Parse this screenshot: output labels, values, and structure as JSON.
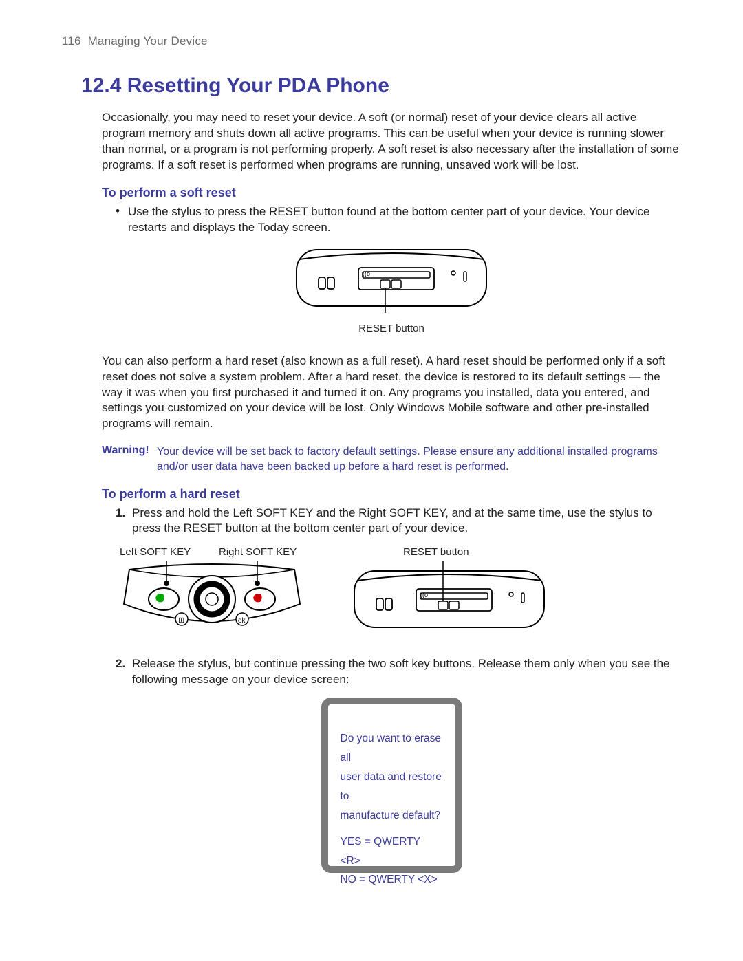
{
  "header": {
    "page_number": "116",
    "chapter": "Managing Your Device"
  },
  "title": "12.4  Resetting Your PDA Phone",
  "intro": "Occasionally, you may need to reset your device. A soft (or normal) reset of your device clears all active program memory and shuts down all active programs. This can be useful when your device is running slower than normal, or a program is not performing properly. A soft reset is also necessary after the installation of some programs. If a soft reset is performed when programs are running, unsaved work will be lost.",
  "soft_reset": {
    "heading": "To perform a soft reset",
    "bullet": "Use the stylus to press the RESET button found at the bottom center part of your device. Your device restarts and displays the Today screen.",
    "caption": "RESET button"
  },
  "hard_reset_intro": "You can also perform a hard reset (also known as a full reset). A hard reset should be performed only if a soft reset does not solve a system problem. After a hard reset, the device is restored to its default settings — the way it was when you first purchased it and turned it on. Any programs you installed, data you entered, and settings you customized on your device will be lost. Only Windows Mobile software and other pre-installed programs will remain.",
  "warning": {
    "label": "Warning!",
    "text": "Your device will be set back to factory default settings. Please ensure any additional installed programs and/or user data have been backed up before a hard reset is performed."
  },
  "hard_reset": {
    "heading": "To perform a hard reset",
    "step1": "Press and hold the Left SOFT KEY and the Right SOFT KEY, and at the same time, use the stylus to press the RESET button at the bottom center part of your device.",
    "labels": {
      "left_key": "Left SOFT KEY",
      "right_key": "Right SOFT KEY",
      "reset": "RESET button"
    },
    "step2": "Release the stylus, but continue pressing the two soft key buttons. Release them only when you see the following message on your device screen:"
  },
  "screen": {
    "line1": "Do you want to erase all",
    "line2": "user data and restore to",
    "line3": "manufacture default?",
    "yes": "YES = QWERTY <R>",
    "no": "NO = QWERTY <X>"
  }
}
